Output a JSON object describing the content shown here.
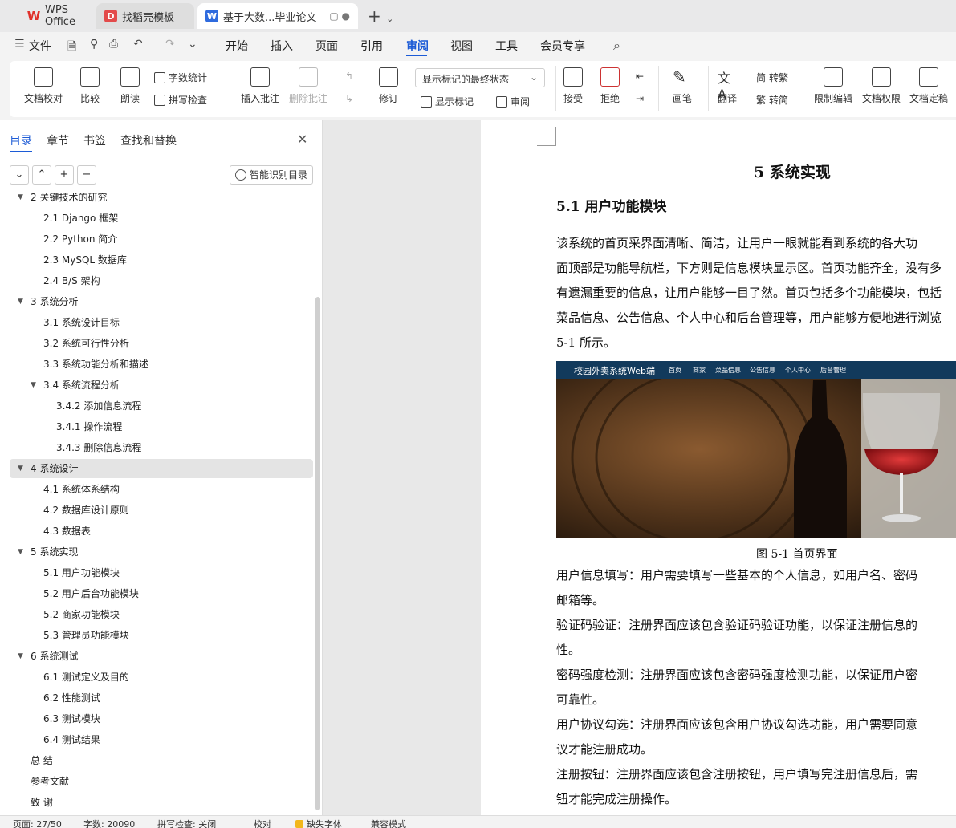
{
  "tabs": {
    "wps": "WPS Office",
    "templates": "找稻壳模板",
    "doc": "基于大数...毕业论文"
  },
  "menu": {
    "file": "文件",
    "items": [
      "开始",
      "插入",
      "页面",
      "引用",
      "审阅",
      "视图",
      "工具",
      "会员专享"
    ],
    "active": "审阅"
  },
  "ribbon": {
    "proof": "文档校对",
    "compare": "比较",
    "read": "朗读",
    "wordcount": "字数统计",
    "spellcheck": "拼写检查",
    "insert_comment": "插入批注",
    "delete_comment": "删除批注",
    "revise": "修订",
    "markup_state": "显示标记的最终状态",
    "show_markup": "显示标记",
    "review": "审阅",
    "accept": "接受",
    "reject": "拒绝",
    "pen": "画笔",
    "translate": "翻译",
    "to_traditional": "转繁",
    "to_simplified": "转简",
    "restrict_edit": "限制编辑",
    "doc_permission": "文档权限",
    "doc_finalize": "文档定稿"
  },
  "nav": {
    "tabs": [
      "目录",
      "章节",
      "书签",
      "查找和替换"
    ],
    "smart_toc": "智能识别目录",
    "toc": [
      {
        "label": "2  关键技术的研究",
        "level": 1,
        "caret": true
      },
      {
        "label": "2.1 Django 框架",
        "level": 2
      },
      {
        "label": "2.2 Python 简介",
        "level": 2
      },
      {
        "label": "2.3 MySQL 数据库",
        "level": 2
      },
      {
        "label": "2.4 B/S 架构",
        "level": 2
      },
      {
        "label": "3  系统分析",
        "level": 1,
        "caret": true
      },
      {
        "label": "3.1  系统设计目标",
        "level": 2
      },
      {
        "label": "3.2  系统可行性分析",
        "level": 2
      },
      {
        "label": "3.3  系统功能分析和描述",
        "level": 2
      },
      {
        "label": "3.4 系统流程分析",
        "level": 2,
        "caret": true
      },
      {
        "label": "3.4.2 添加信息流程",
        "level": 3
      },
      {
        "label": "3.4.1 操作流程",
        "level": 3
      },
      {
        "label": "3.4.3 删除信息流程",
        "level": 3
      },
      {
        "label": "4  系统设计",
        "level": 1,
        "caret": true,
        "selected": true
      },
      {
        "label": "4.1  系统体系结构",
        "level": 2
      },
      {
        "label": "4.2  数据库设计原则",
        "level": 2
      },
      {
        "label": "4.3  数据表",
        "level": 2
      },
      {
        "label": "5  系统实现",
        "level": 1,
        "caret": true
      },
      {
        "label": "5.1 用户功能模块",
        "level": 2
      },
      {
        "label": "5.2 用户后台功能模块",
        "level": 2
      },
      {
        "label": "5.2 商家功能模块",
        "level": 2
      },
      {
        "label": "5.3 管理员功能模块",
        "level": 2
      },
      {
        "label": "6  系统测试",
        "level": 1,
        "caret": true
      },
      {
        "label": "6.1 测试定义及目的",
        "level": 2
      },
      {
        "label": "6.2 性能测试",
        "level": 2
      },
      {
        "label": "6.3 测试模块",
        "level": 2
      },
      {
        "label": "6.4 测试结果",
        "level": 2
      },
      {
        "label": "总  结",
        "level": 1
      },
      {
        "label": "参考文献",
        "level": 1
      },
      {
        "label": "致  谢",
        "level": 1
      }
    ]
  },
  "document": {
    "chapter_title": "5  系统实现",
    "section_title": "5.1 用户功能模块",
    "lines": [
      "    该系统的首页采界面清晰、简洁，让用户一眼就能看到系统的各大功",
      "面顶部是功能导航栏，下方则是信息模块显示区。首页功能齐全，没有多",
      "有遗漏重要的信息，让用户能够一目了然。首页包括多个功能模块，包括",
      "菜品信息、公告信息、个人中心和后台管理等，用户能够方便地进行浏览",
      "5-1 所示。"
    ],
    "figure": {
      "brand": "校园外卖系统Web端",
      "nav": [
        "首页",
        "商家",
        "菜品信息",
        "公告信息",
        "个人中心",
        "后台管理"
      ],
      "caption": "图 5-1    首页界面"
    },
    "lines2": [
      "    用户信息填写：用户需要填写一些基本的个人信息，如用户名、密码",
      "邮箱等。",
      "    验证码验证：注册界面应该包含验证码验证功能，以保证注册信息的",
      "性。",
      "    密码强度检测：注册界面应该包含密码强度检测功能，以保证用户密",
      "可靠性。",
      "    用户协议勾选：注册界面应该包含用户协议勾选功能，用户需要同意",
      "议才能注册成功。",
      "    注册按钮：注册界面应该包含注册按钮，用户填写完注册信息后，需",
      "钮才能完成注册操作。"
    ]
  },
  "status": {
    "page": "页面: 27/50",
    "words": "字数: 20090",
    "spell": "拼写检查: 关闭",
    "proof": "校对",
    "missing_font": "缺失字体",
    "compat": "兼容模式"
  }
}
